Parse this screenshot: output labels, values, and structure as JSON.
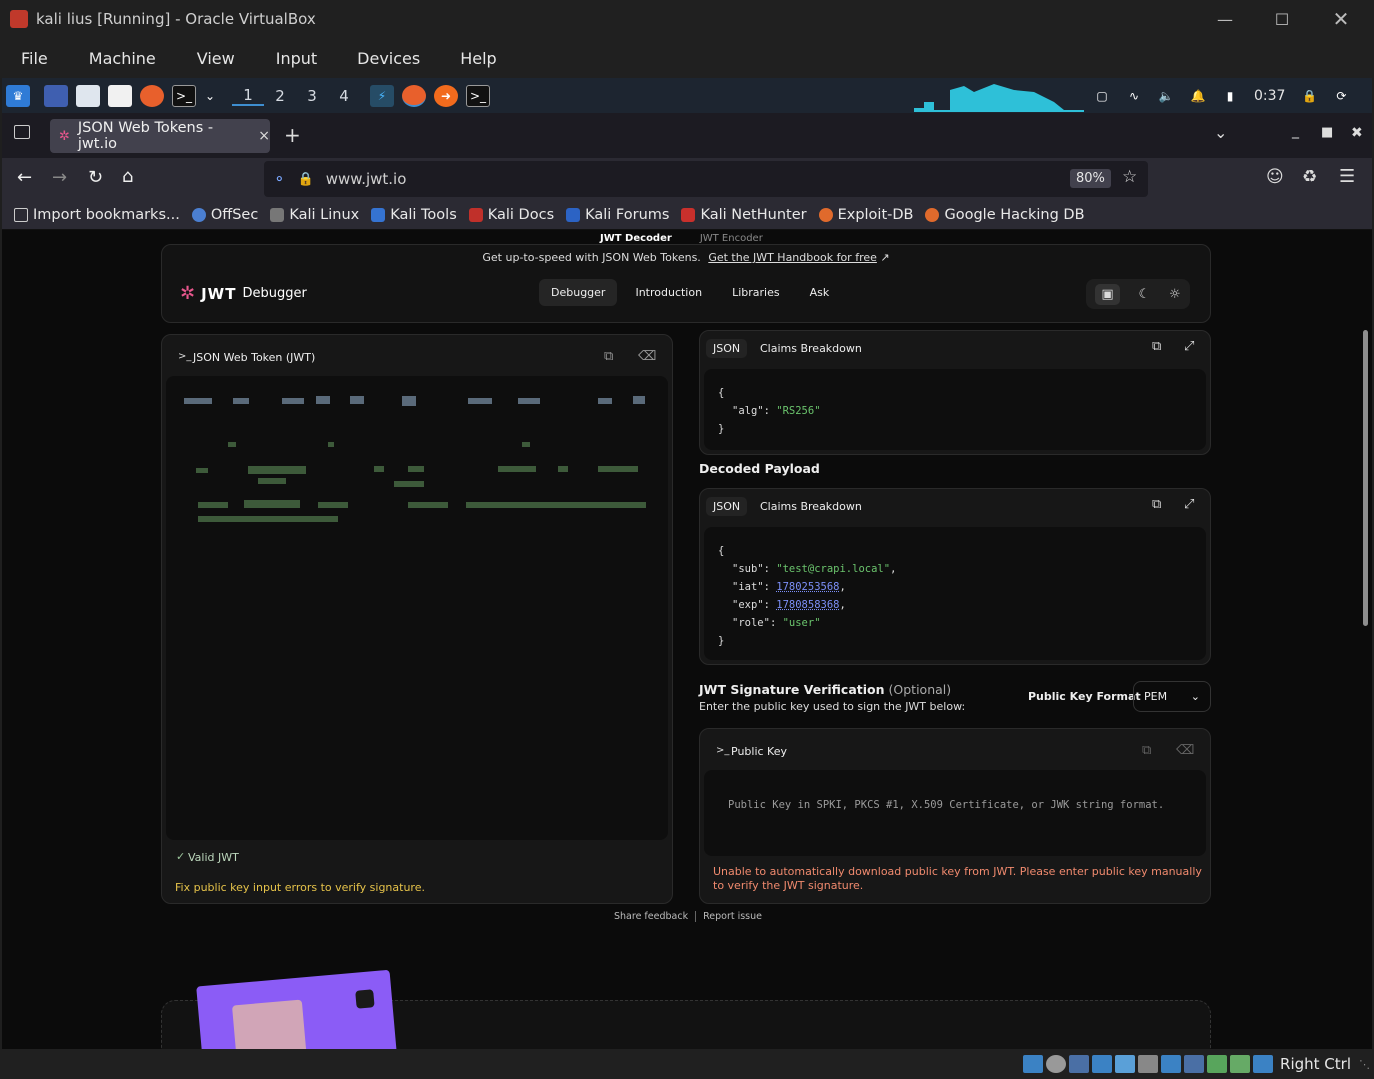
{
  "window": {
    "title": "kali lius [Running] - Oracle VirtualBox"
  },
  "menu": [
    "File",
    "Machine",
    "View",
    "Input",
    "Devices",
    "Help"
  ],
  "panel": {
    "workspaces": [
      "1",
      "2",
      "3",
      "4"
    ],
    "clock": "0:37"
  },
  "browser": {
    "tab_title": "JSON Web Tokens - jwt.io",
    "url": "www.jwt.io",
    "zoom": "80%",
    "bookmarks": [
      "Import bookmarks...",
      "OffSec",
      "Kali Linux",
      "Kali Tools",
      "Kali Docs",
      "Kali Forums",
      "Kali NetHunter",
      "Exploit-DB",
      "Google Hacking DB"
    ]
  },
  "page": {
    "top_tabs": [
      "JWT Decoder",
      "JWT Encoder"
    ],
    "banner_text": "Get up-to-speed with JSON Web Tokens.",
    "banner_link": "Get the JWT Handbook for free",
    "logo": "JWT",
    "logo_sub": "Debugger",
    "nav": [
      "Debugger",
      "Introduction",
      "Libraries",
      "Ask"
    ],
    "jwt_panel_title": "JSON Web Token (JWT)",
    "valid_label": "Valid JWT",
    "fix_error": "Fix public key input errors to verify signature.",
    "header_tabs": {
      "json": "JSON",
      "claims": "Claims Breakdown"
    },
    "header_json": {
      "open": "{",
      "key": "\"alg\"",
      "colon": ": ",
      "value": "\"RS256\"",
      "close": "}"
    },
    "decoded_payload_title": "Decoded Payload",
    "payload_tabs": {
      "json": "JSON",
      "claims": "Claims Breakdown"
    },
    "payload_json": {
      "open": "{",
      "lines": [
        {
          "key": "\"sub\"",
          "value": "\"test@crapi.local\"",
          "comma": ","
        },
        {
          "key": "\"iat\"",
          "value": "1780253568",
          "comma": ","
        },
        {
          "key": "\"exp\"",
          "value": "1780858368",
          "comma": ","
        },
        {
          "key": "\"role\"",
          "value": "\"user\"",
          "comma": ""
        }
      ],
      "close": "}"
    },
    "sig_title": "JWT Signature Verification",
    "sig_optional": "(Optional)",
    "sig_desc": "Enter the public key used to sign the JWT below:",
    "pk_format_label": "Public Key Format",
    "pk_format_value": "PEM",
    "public_key_title": "Public Key",
    "public_key_placeholder": "Public Key in SPKI, PKCS #1, X.509 Certificate, or JWK string format.",
    "pk_error": "Unable to automatically download public key from JWT. Please enter public key manually to verify the JWT signature.",
    "footer": [
      "Share feedback",
      "Report issue"
    ]
  },
  "statusbar": {
    "host_key": "Right Ctrl"
  }
}
